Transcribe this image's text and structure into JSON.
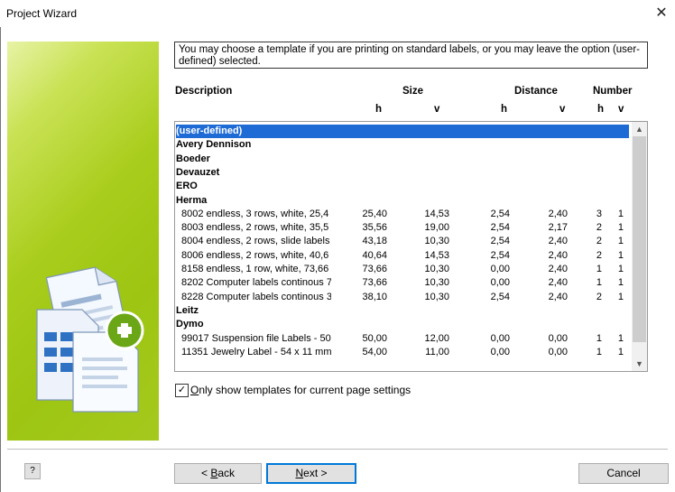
{
  "window": {
    "title": "Project Wizard",
    "close_glyph": "✕"
  },
  "instructions": "You may choose a template if you are printing on standard labels, or you may leave the option (user-defined) selected.",
  "headers": {
    "description": "Description",
    "size": "Size",
    "distance": "Distance",
    "number": "Number",
    "size_h": "h",
    "size_v": "v",
    "distance_h": "h",
    "distance_v": "v",
    "number_h": "h",
    "number_v": "v"
  },
  "templates": [
    {
      "desc": "(user-defined)",
      "group": true,
      "selected": true
    },
    {
      "desc": "Avery Dennison",
      "group": true
    },
    {
      "desc": "Boeder",
      "group": true
    },
    {
      "desc": "Devauzet",
      "group": true
    },
    {
      "desc": "ERO",
      "group": true
    },
    {
      "desc": "Herma",
      "group": true
    },
    {
      "desc": "8002 endless, 3 rows, white, 25,4",
      "size_h": "25,40",
      "size_v": "14,53",
      "dist_h": "2,54",
      "dist_v": "2,40",
      "num_h": "3",
      "num_v": "1"
    },
    {
      "desc": "8003 endless, 2 rows, white, 35,5",
      "size_h": "35,56",
      "size_v": "19,00",
      "dist_h": "2,54",
      "dist_v": "2,17",
      "num_h": "2",
      "num_v": "1"
    },
    {
      "desc": "8004 endless, 2 rows, slide labels",
      "size_h": "43,18",
      "size_v": "10,30",
      "dist_h": "2,54",
      "dist_v": "2,40",
      "num_h": "2",
      "num_v": "1"
    },
    {
      "desc": "8006 endless, 2 rows, white, 40,6",
      "size_h": "40,64",
      "size_v": "14,53",
      "dist_h": "2,54",
      "dist_v": "2,40",
      "num_h": "2",
      "num_v": "1"
    },
    {
      "desc": "8158 endless, 1 row, white, 73,66",
      "size_h": "73,66",
      "size_v": "10,30",
      "dist_h": "0,00",
      "dist_v": "2,40",
      "num_h": "1",
      "num_v": "1"
    },
    {
      "desc": "8202 Computer labels continous 7",
      "size_h": "73,66",
      "size_v": "10,30",
      "dist_h": "0,00",
      "dist_v": "2,40",
      "num_h": "1",
      "num_v": "1"
    },
    {
      "desc": "8228 Computer labels continous 3",
      "size_h": "38,10",
      "size_v": "10,30",
      "dist_h": "2,54",
      "dist_v": "2,40",
      "num_h": "2",
      "num_v": "1"
    },
    {
      "desc": "Leitz",
      "group": true
    },
    {
      "desc": "Dymo",
      "group": true
    },
    {
      "desc": "99017 Suspension file Labels - 50",
      "size_h": "50,00",
      "size_v": "12,00",
      "dist_h": "0,00",
      "dist_v": "0,00",
      "num_h": "1",
      "num_v": "1"
    },
    {
      "desc": "11351 Jewelry Label - 54 x 11 mm",
      "size_h": "54,00",
      "size_v": "11,00",
      "dist_h": "0,00",
      "dist_v": "0,00",
      "num_h": "1",
      "num_v": "1"
    }
  ],
  "checkbox": {
    "label": "Only show templates for current page settings",
    "checked": true,
    "glyph": "✓"
  },
  "buttons": {
    "help": "?",
    "back": "< Back",
    "next": "Next >",
    "cancel": "Cancel"
  },
  "scroll": {
    "up": "▲",
    "down": "▼"
  },
  "colors": {
    "accent": "#a9cd1c",
    "selection": "#1f6bd6",
    "focus": "#0078d7"
  }
}
